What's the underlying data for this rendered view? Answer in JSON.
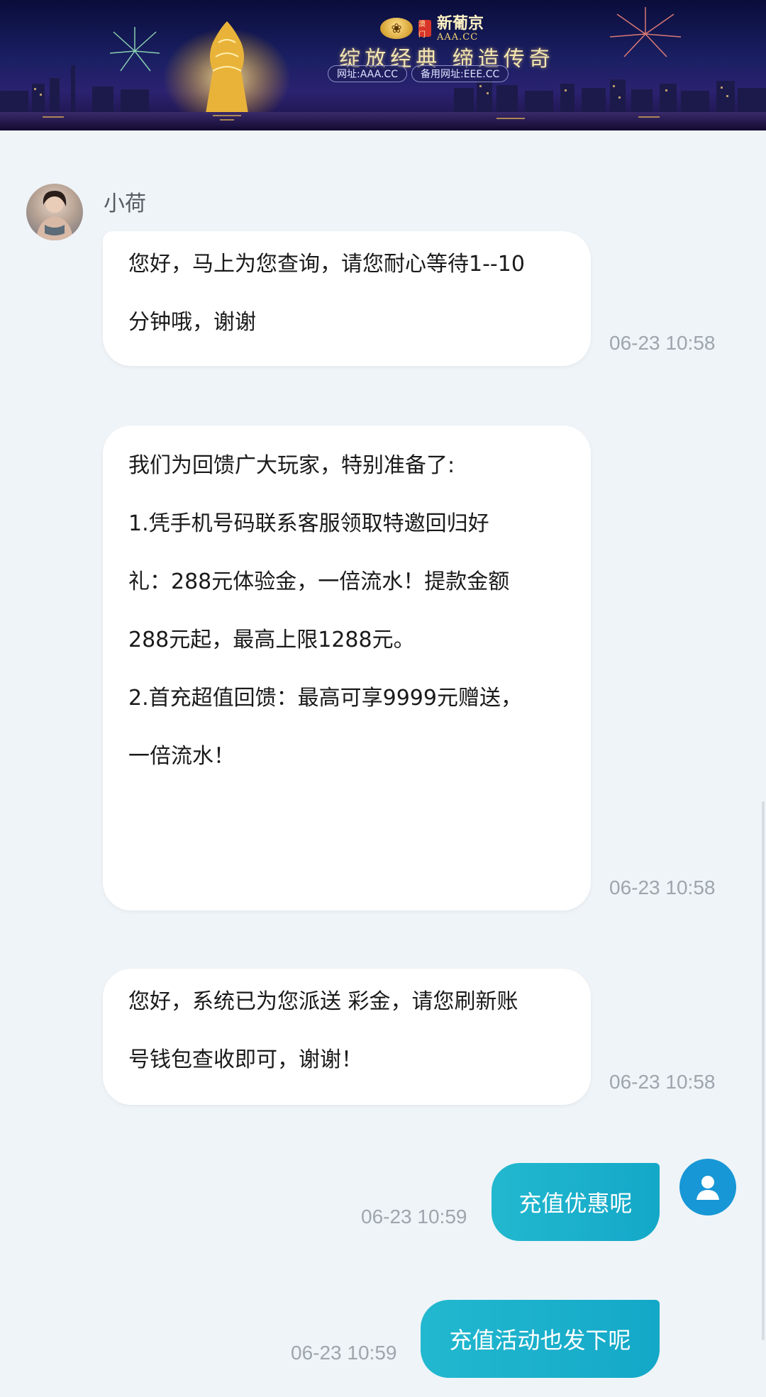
{
  "banner": {
    "brand_name": "新葡京",
    "brand_domain": "AAA.CC",
    "brand_seal": "澳门",
    "slogan": "绽放经典 缔造传奇",
    "url_main": "网址:AAA.CC",
    "url_backup": "备用网址:EEE.CC"
  },
  "agent": {
    "name": "小荷"
  },
  "messages": {
    "m1_line1": "您好，马上为您查询，请您耐心等待1--10",
    "m1_line2": "分钟哦，谢谢",
    "m1_time": "06-23 10:58",
    "m2_line1": "我们为回馈广大玩家，特别准备了:",
    "m2_line2": "1.凭手机号码联系客服领取特邀回归好",
    "m2_line3": "礼：288元体验金，一倍流水！提款金额",
    "m2_line4": "288元起，最高上限1288元。",
    "m2_line5": "2.首充超值回馈：最高可享9999元赠送，",
    "m2_line6": "一倍流水！",
    "m2_time": "06-23 10:58",
    "m3_line1": "您好，系统已为您派送 彩金，请您刷新账",
    "m3_line2": "号钱包查收即可，谢谢！",
    "m3_time": "06-23 10:58",
    "u1_text": "充值优惠呢",
    "u1_time": "06-23 10:59",
    "u2_text": "充值活动也发下呢",
    "u2_time": "06-23 10:59"
  },
  "colors": {
    "user_bubble": "#1ab2cc",
    "agent_bubble": "#ffffff",
    "background": "#eff4f8",
    "timestamp": "#9ea5ad",
    "user_avatar": "#1797d6"
  },
  "icons": {
    "user_avatar": "user-icon",
    "agent_avatar": "agent-photo"
  }
}
